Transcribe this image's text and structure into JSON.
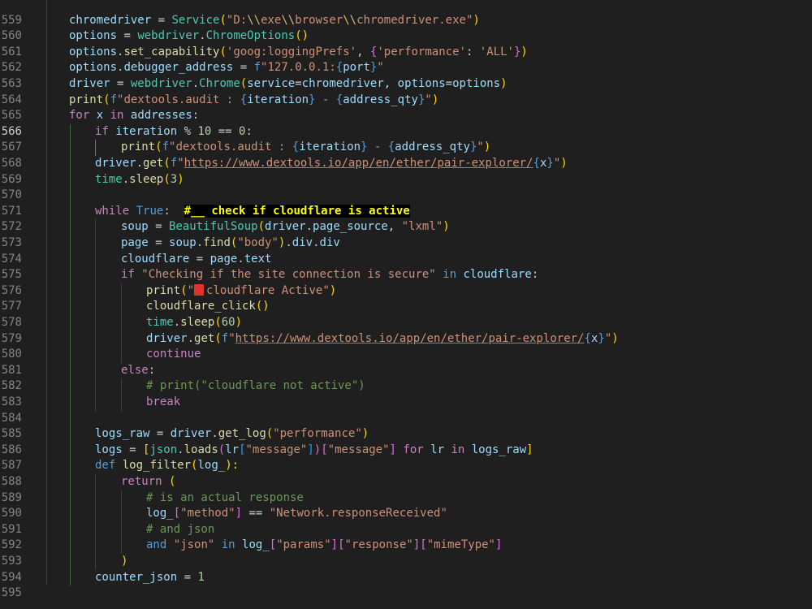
{
  "colors": {
    "background": "#1f1f1f",
    "line_number": "#858585",
    "keyword": "#569cd6",
    "control": "#c586c0",
    "function": "#dcdcaa",
    "class": "#4ec9b0",
    "string": "#ce9178",
    "number": "#b5cea8",
    "variable": "#9cdcfe",
    "comment": "#6a9955",
    "highlight_fg": "#ffff00",
    "highlight_bg": "#000000",
    "emoji_red": "#e0342b"
  },
  "active_line": "566",
  "line_numbers": [
    "559",
    "560",
    "561",
    "562",
    "563",
    "564",
    "565",
    "566",
    "567",
    "568",
    "569",
    "570",
    "571",
    "572",
    "573",
    "574",
    "575",
    "576",
    "577",
    "578",
    "579",
    "580",
    "581",
    "582",
    "583",
    "584",
    "585",
    "586",
    "587",
    "588",
    "589",
    "590",
    "591",
    "592",
    "593",
    "594",
    "595"
  ],
  "code": {
    "l560": {
      "a": "chromedriver",
      "b": " = ",
      "c": "Service",
      "d": "(",
      "e": "\"D:",
      "f": "\\\\",
      "g": "exe",
      "h": "\\\\",
      "i": "browser",
      "j": "\\\\",
      "k": "chromedriver.exe\"",
      "l": ")"
    },
    "l561": {
      "a": "options",
      "b": " = ",
      "c": "webdriver",
      "d": ".",
      "e": "ChromeOptions",
      "f": "()"
    },
    "l562": {
      "a": "options",
      "b": ".",
      "c": "set_capability",
      "d": "(",
      "e": "'goog:loggingPrefs'",
      "f": ", ",
      "g": "{",
      "h": "'performance'",
      "i": ": ",
      "j": "'ALL'",
      "k": "}",
      "l": ")"
    },
    "l563": {
      "a": "options",
      "b": ".",
      "c": "debugger_address",
      "d": " = ",
      "e": "f",
      "f": "\"127.0.0.1:",
      "g": "{",
      "h": "port",
      "i": "}",
      "j": "\""
    },
    "l564": {
      "a": "driver",
      "b": " = ",
      "c": "webdriver",
      "d": ".",
      "e": "Chrome",
      "f": "(",
      "g": "service",
      "h": "=",
      "i": "chromedriver",
      "j": ", ",
      "k": "options",
      "l": "=",
      "m": "options",
      "n": ")"
    },
    "l565": {
      "a": "print",
      "b": "(",
      "c": "f",
      "d": "\"dextools.audit : ",
      "e": "{",
      "f": "iteration",
      "g": "}",
      "h": " - ",
      "i": "{",
      "j": "address_qty",
      "k": "}",
      "l": "\"",
      "m": ")"
    },
    "l566": {
      "a": "for",
      "b": " ",
      "c": "x",
      "d": " ",
      "e": "in",
      "f": " ",
      "g": "addresses",
      "h": ":"
    },
    "l567": {
      "a": "if",
      "b": " ",
      "c": "iteration",
      "d": " % ",
      "e": "10",
      "f": " == ",
      "g": "0",
      "h": ":"
    },
    "l568": {
      "a": "print",
      "b": "(",
      "c": "f",
      "d": "\"dextools.audit : ",
      "e": "{",
      "f": "iteration",
      "g": "}",
      "h": " - ",
      "i": "{",
      "j": "address_qty",
      "k": "}",
      "l": "\"",
      "m": ")"
    },
    "l569": {
      "a": "driver",
      "b": ".",
      "c": "get",
      "d": "(",
      "e": "f",
      "f": "\"",
      "g": "https://www.dextools.io/app/en/ether/pair-explorer/",
      "h": "{",
      "i": "x",
      "j": "}",
      "k": "\"",
      "l": ")"
    },
    "l570": {
      "a": "time",
      "b": ".",
      "c": "sleep",
      "d": "(",
      "e": "3",
      "f": ")"
    },
    "l572": {
      "a": "while",
      "b": " ",
      "c": "True",
      "d": ":  ",
      "e": "#__ check if cloudflare is active"
    },
    "l573": {
      "a": "soup",
      "b": " = ",
      "c": "BeautifulSoup",
      "d": "(",
      "e": "driver",
      "f": ".",
      "g": "page_source",
      "h": ", ",
      "i": "\"lxml\"",
      "j": ")"
    },
    "l574": {
      "a": "page",
      "b": " = ",
      "c": "soup",
      "d": ".",
      "e": "find",
      "f": "(",
      "g": "\"body\"",
      "h": ")",
      "i": ".",
      "j": "div",
      "k": ".",
      "l": "div"
    },
    "l575": {
      "a": "cloudflare",
      "b": " = ",
      "c": "page",
      "d": ".",
      "e": "text"
    },
    "l576": {
      "a": "if",
      "b": " ",
      "c": "\"Checking if the site connection is secure\"",
      "d": " ",
      "e": "in",
      "f": " ",
      "g": "cloudflare",
      "h": ":"
    },
    "l577": {
      "a": "print",
      "b": "(",
      "c": "\"",
      "d": "cloudflare Active\"",
      "e": ")"
    },
    "l578": {
      "a": "cloudflare_click",
      "b": "()"
    },
    "l579": {
      "a": "time",
      "b": ".",
      "c": "sleep",
      "d": "(",
      "e": "60",
      "f": ")"
    },
    "l580": {
      "a": "driver",
      "b": ".",
      "c": "get",
      "d": "(",
      "e": "f",
      "f": "\"",
      "g": "https://www.dextools.io/app/en/ether/pair-explorer/",
      "h": "{",
      "i": "x",
      "j": "}",
      "k": "\"",
      "l": ")"
    },
    "l581": {
      "a": "continue"
    },
    "l582": {
      "a": "else",
      "b": ":"
    },
    "l583": {
      "a": "# print(\"cloudflare not active\")"
    },
    "l584": {
      "a": "break"
    },
    "l586": {
      "a": "logs_raw",
      "b": " = ",
      "c": "driver",
      "d": ".",
      "e": "get_log",
      "f": "(",
      "g": "\"performance\"",
      "h": ")"
    },
    "l587": {
      "a": "logs",
      "b": " = ",
      "c": "[",
      "d": "json",
      "e": ".",
      "f": "loads",
      "g": "(",
      "h": "lr",
      "i": "[",
      "j": "\"message\"",
      "k": "]",
      "l": ")",
      "m": "[",
      "n": "\"message\"",
      "o": "]",
      "p": " ",
      "q": "for",
      "r": " ",
      "s": "lr",
      "t": " ",
      "u": "in",
      "v": " ",
      "w": "logs_raw",
      "x": "]"
    },
    "l588": {
      "a": "def",
      "b": " ",
      "c": "log_filter",
      "d": "(",
      "e": "log_",
      "f": "):"
    },
    "l589": {
      "a": "return",
      "b": " ",
      "c": "("
    },
    "l590": {
      "a": "# is an actual response"
    },
    "l591": {
      "a": "log_",
      "b": "[",
      "c": "\"method\"",
      "d": "]",
      "e": " == ",
      "f": "\"Network.responseReceived\""
    },
    "l592": {
      "a": "# and json"
    },
    "l593": {
      "a": "and",
      "b": " ",
      "c": "\"json\"",
      "d": " ",
      "e": "in",
      "f": " ",
      "g": "log_",
      "h": "[",
      "i": "\"params\"",
      "j": "]",
      "k": "[",
      "l": "\"response\"",
      "m": "]",
      "n": "[",
      "o": "\"mimeType\"",
      "p": "]"
    },
    "l594": {
      "a": ")"
    },
    "l595": {
      "a": "counter_json",
      "b": " = ",
      "c": "1"
    }
  }
}
